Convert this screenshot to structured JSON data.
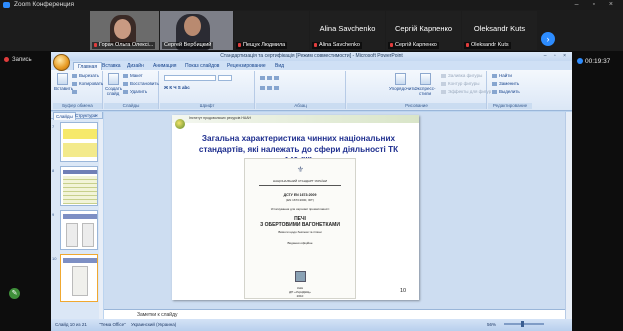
{
  "zoom": {
    "window_title": "Zoom Конференция",
    "recording_label": "Запись",
    "timer": "00:19:37",
    "more_partial": "Lo..."
  },
  "gallery": {
    "participants": [
      {
        "name": "Горач Ольга Олексі...",
        "video": true
      },
      {
        "name": "Сергей Вербицкий",
        "video": true
      },
      {
        "name": "Пещук Людмила",
        "video": false,
        "big_name": ""
      },
      {
        "name": "Alina Savchenko",
        "video": false,
        "big_name": "Alina Savchenko"
      },
      {
        "name": "Сергій Карпенко",
        "video": false,
        "big_name": "Сергій Карпенко"
      },
      {
        "name": "Oleksandr Kuts",
        "video": false,
        "big_name": "Oleksandr Kuts"
      }
    ],
    "next_label": "›"
  },
  "ppt": {
    "title": "Стандартизація та сертифікація [Режим совместимости] - Microsoft PowerPoint",
    "tabs": [
      "Главная",
      "Вставка",
      "Дизайн",
      "Анимация",
      "Показ слайдов",
      "Рецензирование",
      "Вид"
    ],
    "ribbon": {
      "paste": "Вставить",
      "cut": "Вырезать",
      "copy": "Копировать",
      "format": "Формат по образцу",
      "create_slide": "Создать слайд",
      "layout": "Макет",
      "restore": "Восстановить",
      "delete": "Удалить",
      "arrange": "Упорядочить",
      "quick_styles": "Экспресс-стили",
      "shape_fill": "Заливка фигуры",
      "shape_outline": "Контур фигуры",
      "shape_effects": "Эффекты для фигур",
      "find": "Найти",
      "replace": "Заменить",
      "select": "Выделить",
      "groups": [
        "Буфер обмена",
        "Слайды",
        "Шрифт",
        "Абзац",
        "Рисование",
        "Редактирование"
      ]
    },
    "pane_tabs": [
      "Слайды",
      "Структура"
    ],
    "pane_close": "×",
    "thumb_numbers": [
      "7",
      "8",
      "9",
      "10"
    ],
    "notes_placeholder": "Заметки к слайду",
    "status": {
      "slide": "Слайд 10 из 21",
      "theme": "\"Тема Office\"",
      "language": "Украинский (Украина)",
      "zoom": "56%"
    }
  },
  "slide": {
    "institute": "Інститут продовольчих ресурсів НААН",
    "title": "Загальна характеристика чинних національних стандартів, які належать до сфери діяльності ТК 140 (ІІІ)",
    "number": "10",
    "document": {
      "agency": "НАЦІОНАЛЬНИЙ СТАНДАРТ УКРАЇНИ",
      "code": "ДСТУ EN 1673:2009",
      "code2": "(EN 1673:2000, IDT)",
      "adopted": "Устаткування для харчової промисловості",
      "name1": "ПЕЧІ",
      "name2": "З ОБЕРТОВИМИ ВАГОНЕТКАМИ",
      "name3": "Вимоги щодо безпеки та гігієни",
      "edition": "Видання офіційне",
      "city": "Київ",
      "publisher": "ДП «УкрНДНЦ»",
      "year": "2010"
    }
  },
  "colors": {
    "zoom_blue": "#2d8cff",
    "slide_title": "#1f2f8f",
    "ribbon_text": "#15428b",
    "rec_red": "#e03c3c"
  }
}
